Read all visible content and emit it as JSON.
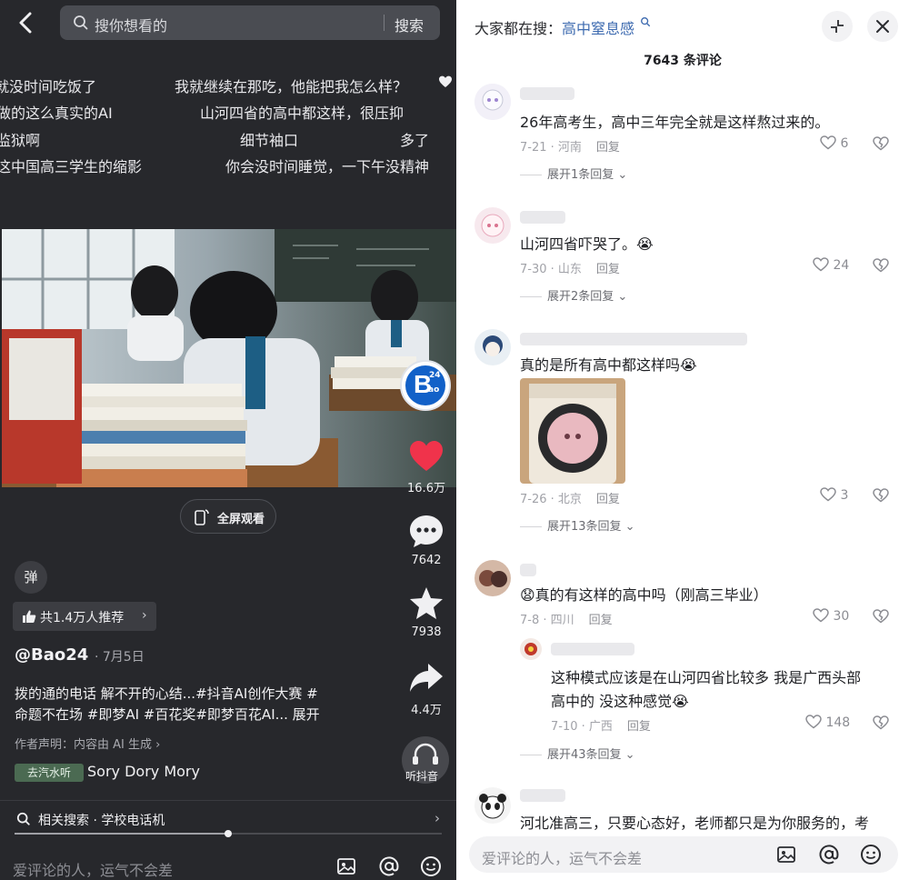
{
  "left": {
    "search": {
      "placeholder": "搜你想看的",
      "button": "搜索"
    },
    "danmaku": [
      "就没时间吃饭了",
      "我就继续在那吃，他能把我怎么样？",
      "做的这么真实的AI",
      "山河四省的高中都这样，很压抑",
      "监狱啊",
      "细节袖口",
      "多了",
      "这中国高三学生的缩影",
      "你会没时间睡觉，一下午没精神"
    ],
    "fullscreen_label": "全屏观看",
    "side_actions": {
      "likes": "16.6万",
      "comments": "7642",
      "favorites": "7938",
      "shares": "4.4万",
      "listen": "听抖音"
    },
    "danmaku_toggle": "弹",
    "recommend": "共1.4万人推荐",
    "author": "@Bao24",
    "date": "· 7月5日",
    "description_line1": "拨的通的电话 解不开的心结...#抖音AI创作大赛 #",
    "description_line2": "命题不在场 #即梦AI #百花奖#即梦百花AI...  展开",
    "declaration": "作者声明：内容由 AI 生成 ›",
    "music_tag": "去汽水听",
    "music": "Sory Dory Mory",
    "related_search": "相关搜索 · 学校电话机",
    "progress": 0.5,
    "comment_placeholder": "爱评论的人，运气不会差",
    "avatar_badge": {
      "top": "24",
      "letter": "B",
      "bottom": "ao"
    }
  },
  "right": {
    "hot_search_label": "大家都在搜：",
    "hot_search_keyword": "高中窒息感",
    "comment_count": "7643 条评论",
    "comments": [
      {
        "text": "26年高考生，高中三年完全就是这样熬过来的。",
        "meta": "7-21 · 河南",
        "reply": "回复",
        "likes": "6",
        "expand": "展开1条回复 ⌄"
      },
      {
        "text": "山河四省吓哭了。😭",
        "meta": "7-30 · 山东",
        "reply": "回复",
        "likes": "24",
        "expand": "展开2条回复 ⌄"
      },
      {
        "text": "真的是所有高中都这样吗😭",
        "meta": "7-26 · 北京",
        "reply": "回复",
        "likes": "3",
        "expand": "展开13条回复 ⌄"
      },
      {
        "text": "😧真的有这样的高中吗（刚高三毕业）",
        "meta": "7-8 · 四川",
        "reply": "回复",
        "likes": "30",
        "expand": "展开43条回复 ⌄"
      },
      {
        "text": "河北准高三，只要心态好，老师都只是为你服务的，考"
      }
    ],
    "sub_reply": {
      "line1": "这种模式应该是在山河四省比较多 我是广西头部",
      "line2": "高中的 没这种感觉😭",
      "meta": "7-10 · 广西",
      "reply": "回复",
      "likes": "148"
    },
    "comment_placeholder": "爱评论的人，运气不会差"
  }
}
